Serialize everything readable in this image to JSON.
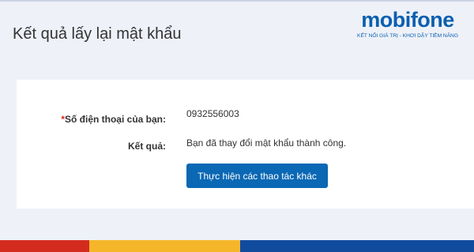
{
  "header": {
    "title": "Kết quả lấy lại mật khẩu",
    "logo": {
      "brand": "mobifone",
      "tagline": "KẾT NỐI GIÁ TRỊ  -  KHƠI DẬY TIỀM NĂNG"
    }
  },
  "form": {
    "required_mark": "*",
    "phone_label": "Số điện thoại của bạn:",
    "phone_value": "0932556003",
    "result_label": "Kết quả:",
    "result_value": "Bạn đã thay đổi mật khẩu thành công.",
    "action_button": "Thực hiện các thao tác khác"
  },
  "colors": {
    "brand_blue": "#0a68b4",
    "brand_red": "#e1261c",
    "footer_red": "#d32c1f",
    "footer_yellow": "#f5b62a",
    "footer_blue": "#104b9e"
  }
}
